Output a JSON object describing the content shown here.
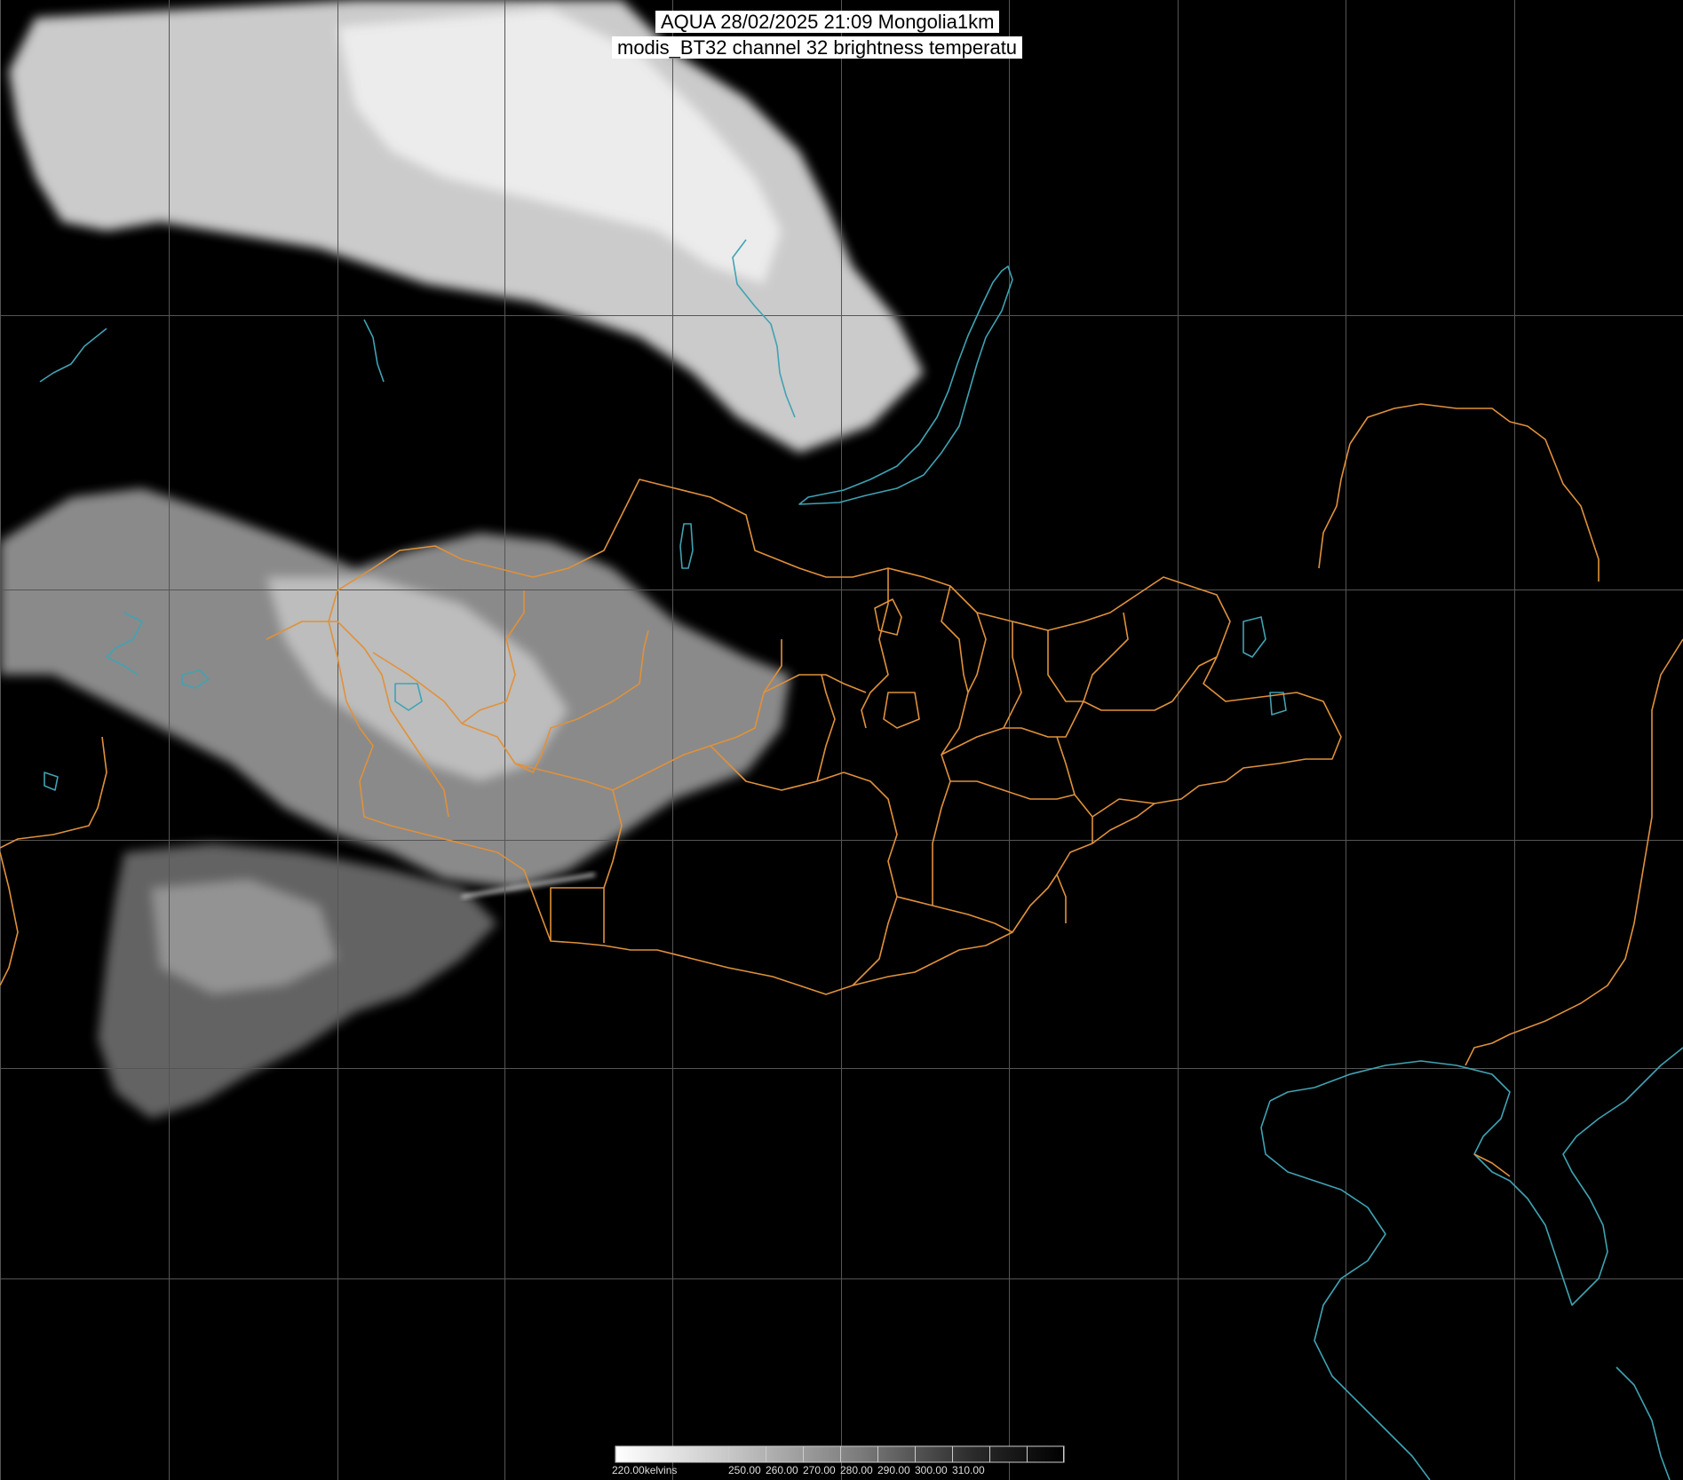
{
  "title": {
    "line1": "AQUA 28/02/2025 21:09 Mongolia1km",
    "line2": "modis_BT32 channel 32 brightness temperatu"
  },
  "colorbar": {
    "labels": [
      "220.00kelvins",
      "250.00",
      "260.00",
      "270.00",
      "280.00",
      "290.00",
      "300.00",
      "310.00"
    ]
  },
  "colors": {
    "background": "#000000",
    "grid": "#555555",
    "admin_borders": "#e0913a",
    "coastlines_water": "#3fa3b3",
    "cloud_bright": "#ffffff",
    "cloud_dim": "#666666"
  }
}
